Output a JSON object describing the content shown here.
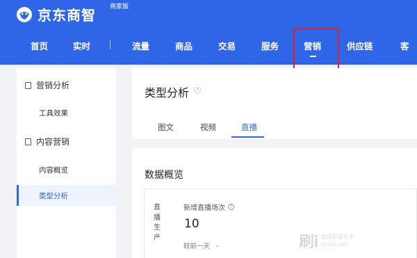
{
  "brand": {
    "title": "京东商智",
    "subtitle": "商家版"
  },
  "nav": {
    "items": [
      {
        "label": "首页"
      },
      {
        "label": "实时"
      },
      {
        "label": "流量"
      },
      {
        "label": "商品"
      },
      {
        "label": "交易"
      },
      {
        "label": "服务"
      },
      {
        "label": "营销"
      },
      {
        "label": "供应链"
      },
      {
        "label": "客"
      }
    ],
    "active": "营销"
  },
  "sidebar": {
    "groups": [
      {
        "label": "营销分析",
        "icon": "clipboard-icon",
        "items": [
          {
            "label": "工具效果"
          }
        ]
      },
      {
        "label": "内容营销",
        "icon": "document-icon",
        "items": [
          {
            "label": "内容概览"
          },
          {
            "label": "类型分析"
          }
        ]
      }
    ],
    "active_item": "类型分析"
  },
  "page": {
    "title": "类型分析",
    "tabs": [
      {
        "label": "图文"
      },
      {
        "label": "视频"
      },
      {
        "label": "直播"
      }
    ],
    "active_tab": "直播"
  },
  "overview": {
    "section_title": "数据概览",
    "card": {
      "vertical_label": "直播生产",
      "metric_label": "新增直播场次",
      "metric_value": "10",
      "compare_label": "较前一天",
      "compare_value": "-"
    }
  },
  "watermark": {
    "logo": "刷i",
    "line1": "值得买设计手",
    "line2": "zhiiru.net"
  },
  "colors": {
    "primary": "#2f66e8",
    "highlight": "#d9252a"
  }
}
